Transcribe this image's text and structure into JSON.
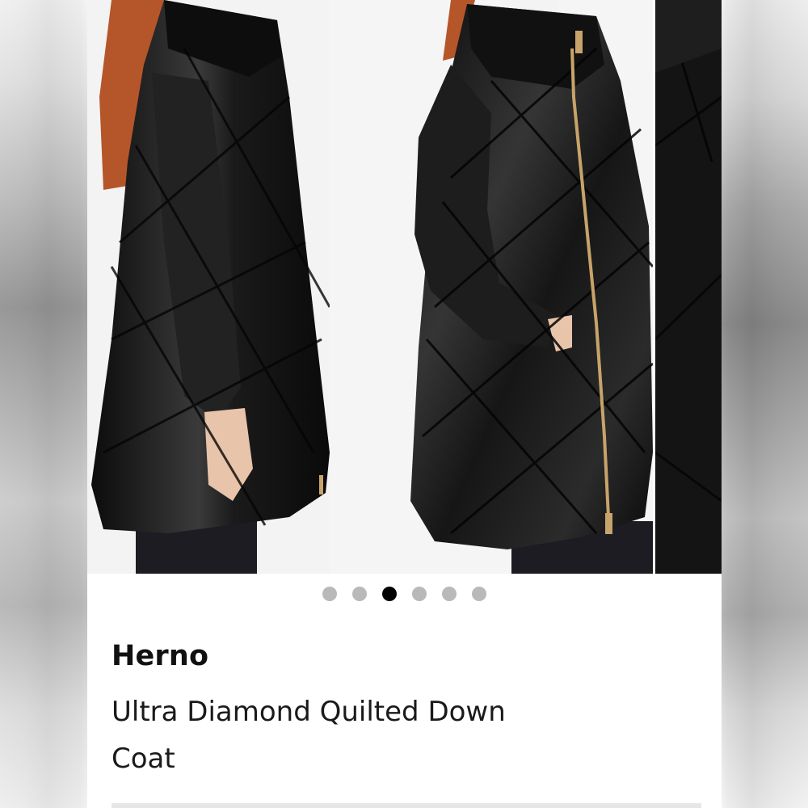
{
  "carousel": {
    "images": [
      {
        "icon": "coat-side-view-photo"
      },
      {
        "icon": "coat-front-view-photo"
      },
      {
        "icon": "coat-next-photo-peek"
      }
    ],
    "dots_count": 6,
    "active_index": 2,
    "colors": {
      "dot_inactive": "#b9b9b9",
      "dot_active": "#000000"
    }
  },
  "product": {
    "brand": "Herno",
    "name": "Ultra Diamond Quilted Down Coat"
  },
  "colors": {
    "coat": "#151515",
    "zipper": "#c8a36a",
    "hair": "#b5562a",
    "background": "#ffffff"
  }
}
